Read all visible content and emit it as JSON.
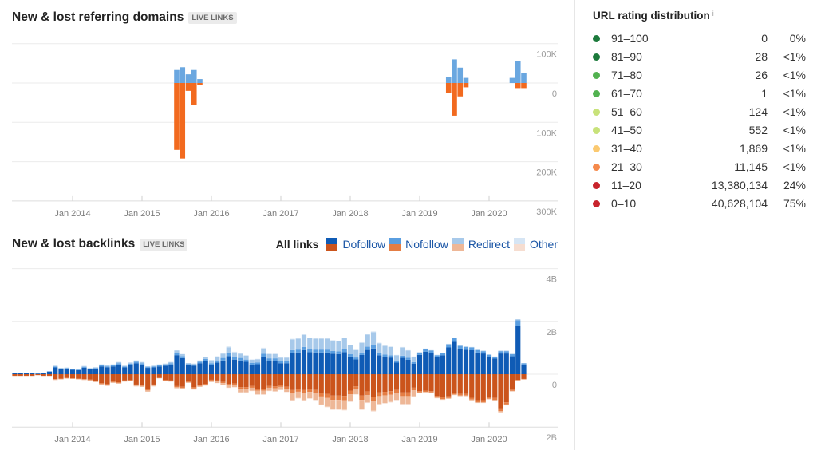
{
  "domains_section": {
    "title": "New & lost referring domains",
    "badge": "LIVE LINKS"
  },
  "backlinks_section": {
    "title": "New & lost backlinks",
    "badge": "LIVE LINKS",
    "legend": {
      "all_label": "All links",
      "items": [
        {
          "label": "Dofollow"
        },
        {
          "label": "Nofollow"
        },
        {
          "label": "Redirect"
        },
        {
          "label": "Other"
        }
      ]
    }
  },
  "url_rating": {
    "title": "URL rating distribution",
    "info_icon": "i",
    "rows": [
      {
        "range": "91–100",
        "count": "0",
        "percent": "0%",
        "color": "#1c7a3c"
      },
      {
        "range": "81–90",
        "count": "28",
        "percent": "<1%",
        "color": "#1c7a3c"
      },
      {
        "range": "71–80",
        "count": "26",
        "percent": "<1%",
        "color": "#52b250"
      },
      {
        "range": "61–70",
        "count": "1",
        "percent": "<1%",
        "color": "#52b250"
      },
      {
        "range": "51–60",
        "count": "124",
        "percent": "<1%",
        "color": "#c8e27a"
      },
      {
        "range": "41–50",
        "count": "552",
        "percent": "<1%",
        "color": "#c8e27a"
      },
      {
        "range": "31–40",
        "count": "1,869",
        "percent": "<1%",
        "color": "#fbc970"
      },
      {
        "range": "21–30",
        "count": "11,145",
        "percent": "<1%",
        "color": "#f58a4c"
      },
      {
        "range": "11–20",
        "count": "13,380,134",
        "percent": "24%",
        "color": "#c8232c"
      },
      {
        "range": "0–10",
        "count": "40,628,104",
        "percent": "75%",
        "color": "#c8232c"
      }
    ]
  },
  "chart_data": [
    {
      "type": "bar",
      "stacked": false,
      "title": "New & lost referring domains",
      "y_unit": "K",
      "ylim": [
        -300,
        100
      ],
      "grid": true,
      "y_ticks": [
        {
          "value": 100,
          "label": "100K"
        },
        {
          "value": 0,
          "label": "0"
        },
        {
          "value": -100,
          "label": "100K"
        },
        {
          "value": -200,
          "label": "200K"
        },
        {
          "value": -300,
          "label": "300K"
        }
      ],
      "x_ticks": [
        {
          "month": "2014-01",
          "label": "Jan 2014"
        },
        {
          "month": "2015-01",
          "label": "Jan 2015"
        },
        {
          "month": "2016-01",
          "label": "Jan 2016"
        },
        {
          "month": "2017-01",
          "label": "Jan 2017"
        },
        {
          "month": "2018-01",
          "label": "Jan 2018"
        },
        {
          "month": "2019-01",
          "label": "Jan 2019"
        },
        {
          "month": "2020-01",
          "label": "Jan 2020"
        }
      ],
      "series": [
        {
          "name": "New",
          "color": "#6aa7e0"
        },
        {
          "name": "Lost",
          "color": "#f26a1f"
        }
      ],
      "points": [
        {
          "month": "2015-07",
          "new": 33,
          "lost": 170
        },
        {
          "month": "2015-08",
          "new": 40,
          "lost": 192
        },
        {
          "month": "2015-09",
          "new": 22,
          "lost": 20
        },
        {
          "month": "2015-10",
          "new": 33,
          "lost": 55
        },
        {
          "month": "2015-11",
          "new": 10,
          "lost": 6
        },
        {
          "month": "2019-06",
          "new": 16,
          "lost": 26
        },
        {
          "month": "2019-07",
          "new": 60,
          "lost": 83
        },
        {
          "month": "2019-08",
          "new": 39,
          "lost": 34
        },
        {
          "month": "2019-09",
          "new": 13,
          "lost": 11
        },
        {
          "month": "2020-05",
          "new": 13,
          "lost": 0
        },
        {
          "month": "2020-06",
          "new": 56,
          "lost": 13
        },
        {
          "month": "2020-07",
          "new": 26,
          "lost": 13
        }
      ]
    },
    {
      "type": "bar",
      "stacked": true,
      "title": "New & lost backlinks",
      "y_unit": "B",
      "ylim": [
        -2,
        4
      ],
      "grid": true,
      "legend_position": "top-right",
      "y_ticks": [
        {
          "value": 4,
          "label": "4B"
        },
        {
          "value": 2,
          "label": "2B"
        },
        {
          "value": 0,
          "label": "0"
        },
        {
          "value": -2,
          "label": "2B"
        }
      ],
      "x_ticks": [
        {
          "month": "2014-01",
          "label": "Jan 2014"
        },
        {
          "month": "2015-01",
          "label": "Jan 2015"
        },
        {
          "month": "2016-01",
          "label": "Jan 2016"
        },
        {
          "month": "2017-01",
          "label": "Jan 2017"
        },
        {
          "month": "2018-01",
          "label": "Jan 2018"
        },
        {
          "month": "2019-01",
          "label": "Jan 2019"
        },
        {
          "month": "2020-01",
          "label": "Jan 2020"
        }
      ],
      "series": [
        {
          "name": "Dofollow",
          "new_color": "#0f5bb5",
          "lost_color": "#cb541c"
        },
        {
          "name": "Nofollow",
          "new_color": "#5a9ee0",
          "lost_color": "#e47d44"
        },
        {
          "name": "Redirect",
          "new_color": "#a7c9ea",
          "lost_color": "#eeb797"
        },
        {
          "name": "Other",
          "new_color": "#d6e5f4",
          "lost_color": "#f6ddd0"
        }
      ],
      "months_start": "2013-03",
      "new_total": [
        0.04,
        0.04,
        0.04,
        0.04,
        0.03,
        0.04,
        0.12,
        0.32,
        0.24,
        0.25,
        0.21,
        0.19,
        0.31,
        0.23,
        0.26,
        0.37,
        0.33,
        0.37,
        0.46,
        0.32,
        0.44,
        0.52,
        0.46,
        0.3,
        0.32,
        0.37,
        0.4,
        0.46,
        0.9,
        0.76,
        0.42,
        0.4,
        0.52,
        0.64,
        0.54,
        0.68,
        0.8,
        1.05,
        0.85,
        0.8,
        0.72,
        0.56,
        0.58,
        1.0,
        0.78,
        0.78,
        0.64,
        0.64,
        1.34,
        1.37,
        1.52,
        1.39,
        1.37,
        1.37,
        1.37,
        1.29,
        1.27,
        1.39,
        1.11,
        0.93,
        1.21,
        1.53,
        1.62,
        1.19,
        1.09,
        1.05,
        0.73,
        1.03,
        0.91,
        0.67,
        0.83,
        0.97,
        0.91,
        0.73,
        0.81,
        1.15,
        1.39,
        1.09,
        1.05,
        1.03,
        0.93,
        0.89,
        0.75,
        0.67,
        0.89,
        0.89,
        0.77,
        2.08,
        0.42
      ],
      "lost_total": [
        0.07,
        0.07,
        0.07,
        0.07,
        0.04,
        0.07,
        0.07,
        0.22,
        0.2,
        0.17,
        0.18,
        0.2,
        0.22,
        0.24,
        0.3,
        0.4,
        0.44,
        0.33,
        0.36,
        0.28,
        0.26,
        0.46,
        0.48,
        0.66,
        0.46,
        0.16,
        0.26,
        0.28,
        0.53,
        0.56,
        0.33,
        0.58,
        0.48,
        0.43,
        0.3,
        0.34,
        0.42,
        0.52,
        0.5,
        0.7,
        0.7,
        0.64,
        0.78,
        0.78,
        0.64,
        0.66,
        0.6,
        0.68,
        1.0,
        0.92,
        1.0,
        0.93,
        0.99,
        1.17,
        1.25,
        1.35,
        1.35,
        1.37,
        1.05,
        0.77,
        1.35,
        1.09,
        1.41,
        1.15,
        1.11,
        1.07,
        0.99,
        1.15,
        1.15,
        0.85,
        0.71,
        0.69,
        0.71,
        0.91,
        0.97,
        0.93,
        0.79,
        0.83,
        0.83,
        0.99,
        1.09,
        1.09,
        0.95,
        1.0,
        1.44,
        1.18,
        0.65,
        0.24,
        0.2
      ],
      "composition": [
        {
          "from": "2013-03",
          "to": "2015-12",
          "new_share": [
            0.8,
            0.1,
            0.1,
            0.0
          ],
          "lost_share": [
            0.85,
            0.08,
            0.07,
            0.0
          ]
        },
        {
          "from": "2016-01",
          "to": "2017-02",
          "new_share": [
            0.65,
            0.12,
            0.2,
            0.03
          ],
          "lost_share": [
            0.7,
            0.1,
            0.18,
            0.02
          ]
        },
        {
          "from": "2017-03",
          "to": "2018-12",
          "new_share": [
            0.6,
            0.08,
            0.3,
            0.02
          ],
          "lost_share": [
            0.6,
            0.12,
            0.26,
            0.02
          ]
        },
        {
          "from": "2019-01",
          "to": "2020-07",
          "new_share": [
            0.88,
            0.1,
            0.02,
            0.0
          ],
          "lost_share": [
            0.9,
            0.07,
            0.03,
            0.0
          ]
        }
      ]
    }
  ]
}
